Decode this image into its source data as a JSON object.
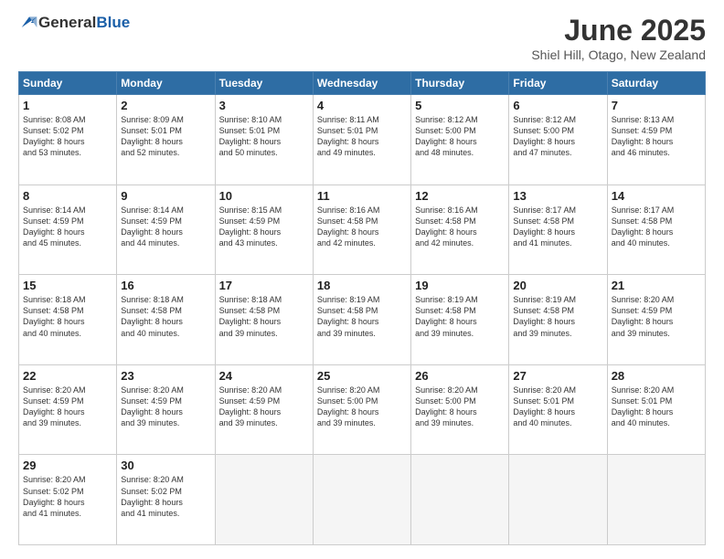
{
  "header": {
    "logo_general": "General",
    "logo_blue": "Blue",
    "title": "June 2025",
    "location": "Shiel Hill, Otago, New Zealand"
  },
  "weekdays": [
    "Sunday",
    "Monday",
    "Tuesday",
    "Wednesday",
    "Thursday",
    "Friday",
    "Saturday"
  ],
  "weeks": [
    [
      {
        "day": "1",
        "lines": [
          "Sunrise: 8:08 AM",
          "Sunset: 5:02 PM",
          "Daylight: 8 hours",
          "and 53 minutes."
        ]
      },
      {
        "day": "2",
        "lines": [
          "Sunrise: 8:09 AM",
          "Sunset: 5:01 PM",
          "Daylight: 8 hours",
          "and 52 minutes."
        ]
      },
      {
        "day": "3",
        "lines": [
          "Sunrise: 8:10 AM",
          "Sunset: 5:01 PM",
          "Daylight: 8 hours",
          "and 50 minutes."
        ]
      },
      {
        "day": "4",
        "lines": [
          "Sunrise: 8:11 AM",
          "Sunset: 5:01 PM",
          "Daylight: 8 hours",
          "and 49 minutes."
        ]
      },
      {
        "day": "5",
        "lines": [
          "Sunrise: 8:12 AM",
          "Sunset: 5:00 PM",
          "Daylight: 8 hours",
          "and 48 minutes."
        ]
      },
      {
        "day": "6",
        "lines": [
          "Sunrise: 8:12 AM",
          "Sunset: 5:00 PM",
          "Daylight: 8 hours",
          "and 47 minutes."
        ]
      },
      {
        "day": "7",
        "lines": [
          "Sunrise: 8:13 AM",
          "Sunset: 4:59 PM",
          "Daylight: 8 hours",
          "and 46 minutes."
        ]
      }
    ],
    [
      {
        "day": "8",
        "lines": [
          "Sunrise: 8:14 AM",
          "Sunset: 4:59 PM",
          "Daylight: 8 hours",
          "and 45 minutes."
        ]
      },
      {
        "day": "9",
        "lines": [
          "Sunrise: 8:14 AM",
          "Sunset: 4:59 PM",
          "Daylight: 8 hours",
          "and 44 minutes."
        ]
      },
      {
        "day": "10",
        "lines": [
          "Sunrise: 8:15 AM",
          "Sunset: 4:59 PM",
          "Daylight: 8 hours",
          "and 43 minutes."
        ]
      },
      {
        "day": "11",
        "lines": [
          "Sunrise: 8:16 AM",
          "Sunset: 4:58 PM",
          "Daylight: 8 hours",
          "and 42 minutes."
        ]
      },
      {
        "day": "12",
        "lines": [
          "Sunrise: 8:16 AM",
          "Sunset: 4:58 PM",
          "Daylight: 8 hours",
          "and 42 minutes."
        ]
      },
      {
        "day": "13",
        "lines": [
          "Sunrise: 8:17 AM",
          "Sunset: 4:58 PM",
          "Daylight: 8 hours",
          "and 41 minutes."
        ]
      },
      {
        "day": "14",
        "lines": [
          "Sunrise: 8:17 AM",
          "Sunset: 4:58 PM",
          "Daylight: 8 hours",
          "and 40 minutes."
        ]
      }
    ],
    [
      {
        "day": "15",
        "lines": [
          "Sunrise: 8:18 AM",
          "Sunset: 4:58 PM",
          "Daylight: 8 hours",
          "and 40 minutes."
        ]
      },
      {
        "day": "16",
        "lines": [
          "Sunrise: 8:18 AM",
          "Sunset: 4:58 PM",
          "Daylight: 8 hours",
          "and 40 minutes."
        ]
      },
      {
        "day": "17",
        "lines": [
          "Sunrise: 8:18 AM",
          "Sunset: 4:58 PM",
          "Daylight: 8 hours",
          "and 39 minutes."
        ]
      },
      {
        "day": "18",
        "lines": [
          "Sunrise: 8:19 AM",
          "Sunset: 4:58 PM",
          "Daylight: 8 hours",
          "and 39 minutes."
        ]
      },
      {
        "day": "19",
        "lines": [
          "Sunrise: 8:19 AM",
          "Sunset: 4:58 PM",
          "Daylight: 8 hours",
          "and 39 minutes."
        ]
      },
      {
        "day": "20",
        "lines": [
          "Sunrise: 8:19 AM",
          "Sunset: 4:58 PM",
          "Daylight: 8 hours",
          "and 39 minutes."
        ]
      },
      {
        "day": "21",
        "lines": [
          "Sunrise: 8:20 AM",
          "Sunset: 4:59 PM",
          "Daylight: 8 hours",
          "and 39 minutes."
        ]
      }
    ],
    [
      {
        "day": "22",
        "lines": [
          "Sunrise: 8:20 AM",
          "Sunset: 4:59 PM",
          "Daylight: 8 hours",
          "and 39 minutes."
        ]
      },
      {
        "day": "23",
        "lines": [
          "Sunrise: 8:20 AM",
          "Sunset: 4:59 PM",
          "Daylight: 8 hours",
          "and 39 minutes."
        ]
      },
      {
        "day": "24",
        "lines": [
          "Sunrise: 8:20 AM",
          "Sunset: 4:59 PM",
          "Daylight: 8 hours",
          "and 39 minutes."
        ]
      },
      {
        "day": "25",
        "lines": [
          "Sunrise: 8:20 AM",
          "Sunset: 5:00 PM",
          "Daylight: 8 hours",
          "and 39 minutes."
        ]
      },
      {
        "day": "26",
        "lines": [
          "Sunrise: 8:20 AM",
          "Sunset: 5:00 PM",
          "Daylight: 8 hours",
          "and 39 minutes."
        ]
      },
      {
        "day": "27",
        "lines": [
          "Sunrise: 8:20 AM",
          "Sunset: 5:01 PM",
          "Daylight: 8 hours",
          "and 40 minutes."
        ]
      },
      {
        "day": "28",
        "lines": [
          "Sunrise: 8:20 AM",
          "Sunset: 5:01 PM",
          "Daylight: 8 hours",
          "and 40 minutes."
        ]
      }
    ],
    [
      {
        "day": "29",
        "lines": [
          "Sunrise: 8:20 AM",
          "Sunset: 5:02 PM",
          "Daylight: 8 hours",
          "and 41 minutes."
        ]
      },
      {
        "day": "30",
        "lines": [
          "Sunrise: 8:20 AM",
          "Sunset: 5:02 PM",
          "Daylight: 8 hours",
          "and 41 minutes."
        ]
      },
      {
        "day": "",
        "lines": []
      },
      {
        "day": "",
        "lines": []
      },
      {
        "day": "",
        "lines": []
      },
      {
        "day": "",
        "lines": []
      },
      {
        "day": "",
        "lines": []
      }
    ]
  ]
}
